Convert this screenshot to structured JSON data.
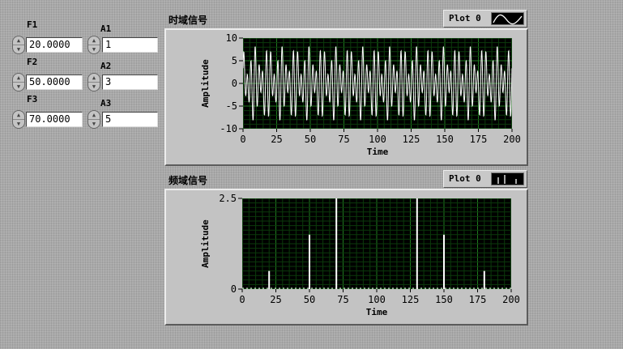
{
  "controls": [
    {
      "freq_label": "F1",
      "freq_value": "20.0000",
      "amp_label": "A1",
      "amp_value": "1"
    },
    {
      "freq_label": "F2",
      "freq_value": "50.0000",
      "amp_label": "A2",
      "amp_value": "3"
    },
    {
      "freq_label": "F3",
      "freq_value": "70.0000",
      "amp_label": "A3",
      "amp_value": "5"
    }
  ],
  "icons": {
    "spinner": "up-down-spinner-icon"
  },
  "colors": {
    "panel_bg": "#a9a9a9",
    "plot_bg": "#000000",
    "grid_major": "#1f7a1f",
    "grid_minor": "#0b3a0b",
    "trace": "#ffffff"
  },
  "chart_data": [
    {
      "type": "line",
      "title": "时域信号",
      "legend": "Plot 0",
      "xlabel": "Time",
      "ylabel": "Amplitude",
      "xlim": [
        0,
        200
      ],
      "ylim": [
        -10,
        10
      ],
      "x_ticks": [
        "0",
        "25",
        "50",
        "75",
        "100",
        "125",
        "150",
        "175",
        "200"
      ],
      "y_ticks": [
        "10",
        "5",
        "0",
        "-5",
        "-10"
      ],
      "series": [
        {
          "components": [
            {
              "frequency": 20,
              "amplitude": 1
            },
            {
              "frequency": 50,
              "amplitude": 3
            },
            {
              "frequency": 70,
              "amplitude": 5
            }
          ]
        }
      ]
    },
    {
      "type": "bar",
      "title": "频域信号",
      "legend": "Plot 0",
      "xlabel": "Time",
      "ylabel": "Amplitude",
      "xlim": [
        0,
        200
      ],
      "ylim": [
        0,
        2.5
      ],
      "x_ticks": [
        "0",
        "25",
        "50",
        "75",
        "100",
        "125",
        "150",
        "175",
        "200"
      ],
      "y_ticks": [
        "2.5",
        "0"
      ],
      "series": [
        {
          "x": [
            20,
            50,
            70,
            130,
            150,
            180
          ],
          "values": [
            0.5,
            1.5,
            2.5,
            2.5,
            1.5,
            0.5
          ]
        }
      ]
    }
  ]
}
